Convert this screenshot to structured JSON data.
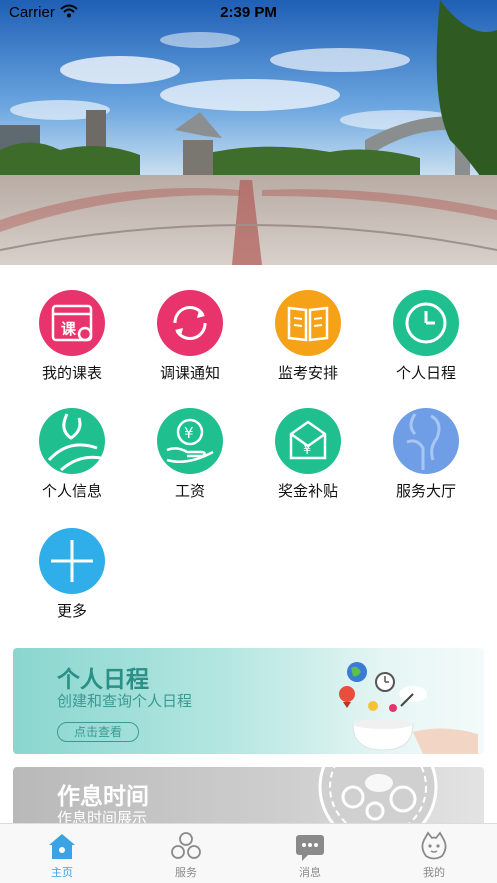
{
  "status_bar": {
    "carrier": "Carrier",
    "time": "2:39 PM"
  },
  "grid_items": [
    {
      "label": "我的课表",
      "icon": "schedule-icon",
      "color": "#e8336d"
    },
    {
      "label": "调课通知",
      "icon": "refresh-icon",
      "color": "#e8336d"
    },
    {
      "label": "监考安排",
      "icon": "book-icon",
      "color": "#f5a218"
    },
    {
      "label": "个人日程",
      "icon": "clock-icon",
      "color": "#1fbf8f"
    },
    {
      "label": "个人信息",
      "icon": "person-icon",
      "color": "#1fbf8f"
    },
    {
      "label": "工资",
      "icon": "yuan-hand-icon",
      "color": "#1fbf8f"
    },
    {
      "label": "奖金补贴",
      "icon": "envelope-yuan-icon",
      "color": "#1fbf8f"
    },
    {
      "label": "服务大厅",
      "icon": "service-icon",
      "color": "#6f9ee6"
    },
    {
      "label": "更多",
      "icon": "plus-icon",
      "color": "#2faeea"
    }
  ],
  "cards": [
    {
      "title": "个人日程",
      "subtitle": "创建和查询个人日程",
      "button": "点击查看"
    },
    {
      "title": "作息时间",
      "subtitle": "作息时间展示"
    }
  ],
  "tabbar": [
    {
      "label": "主页",
      "icon": "home-icon",
      "active": true
    },
    {
      "label": "服务",
      "icon": "services-icon",
      "active": false
    },
    {
      "label": "消息",
      "icon": "message-icon",
      "active": false
    },
    {
      "label": "我的",
      "icon": "profile-icon",
      "active": false
    }
  ],
  "colors": {
    "accent": "#3aa3e3",
    "inactive": "#8a8a8a"
  }
}
